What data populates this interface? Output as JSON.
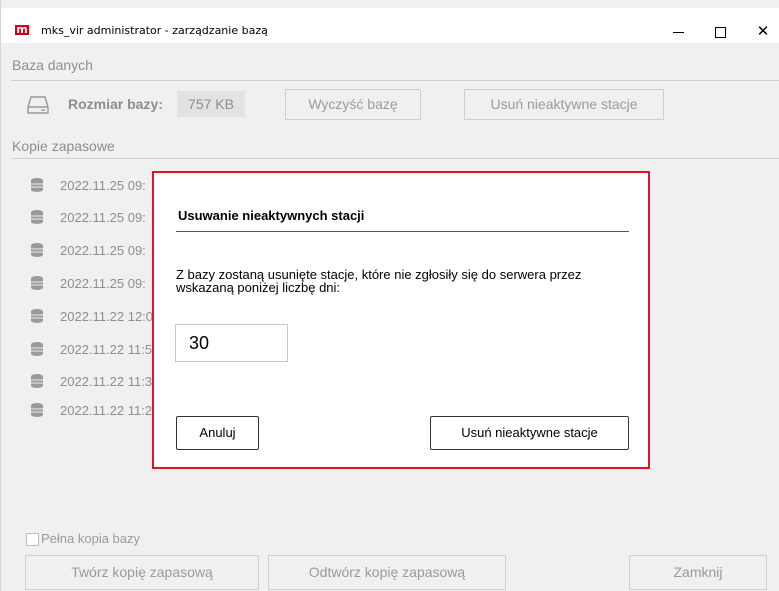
{
  "window": {
    "logo": "m",
    "title": "mks_vir administrator - zarządzanie bazą",
    "close_glyph": "✕"
  },
  "database": {
    "section_title": "Baza danych",
    "size_label": "Rozmiar bazy:",
    "size_value": "757 KB",
    "clear_button": "Wyczyść bazę",
    "remove_inactive_button": "Usuń nieaktywne stacje"
  },
  "backups": {
    "section_title": "Kopie zapasowe",
    "items": [
      {
        "label": "2022.11.25 09:"
      },
      {
        "label": "2022.11.25 09:"
      },
      {
        "label": "2022.11.25 09:"
      },
      {
        "label": "2022.11.25 09:"
      },
      {
        "label": "2022.11.22 12:0"
      },
      {
        "label": "2022.11.22 11:5"
      },
      {
        "label": "2022.11.22 11:3"
      },
      {
        "label": "2022.11.22 11:2"
      }
    ],
    "full_copy_label": "Pełna kopia bazy",
    "create_button": "Twórz kopię zapasową",
    "restore_button": "Odtwórz kopię zapasową",
    "close_button": "Zamknij"
  },
  "dialog": {
    "title": "Usuwanie nieaktywnych stacji",
    "message": "Z bazy zostaną usunięte stacje, które nie zgłosiły się do serwera przez wskazaną poniżej liczbę dni:",
    "days_value": "30",
    "cancel_button": "Anuluj",
    "confirm_button": "Usuń nieaktywne stacje"
  },
  "colors": {
    "brand": "#d1011b",
    "dialog_border": "#e0141c"
  }
}
